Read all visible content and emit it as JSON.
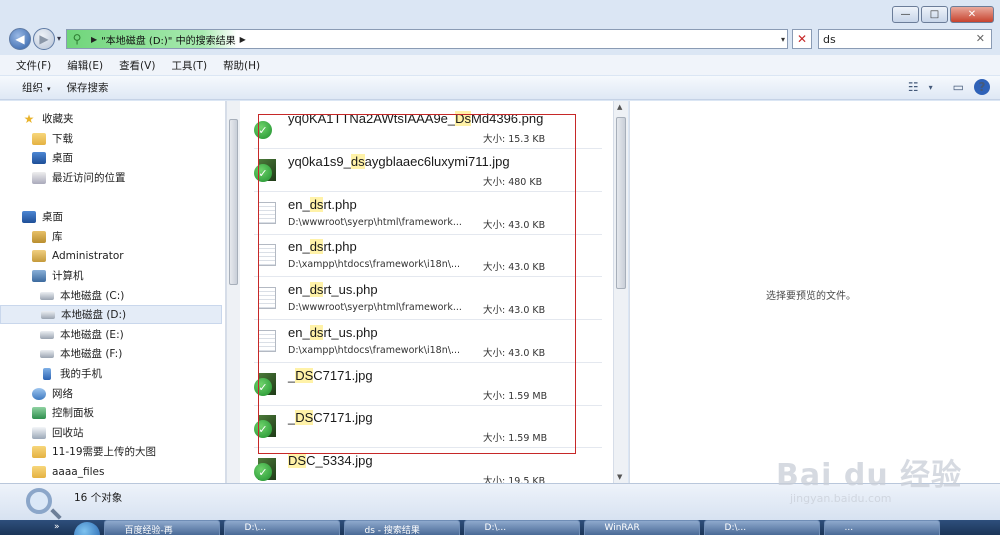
{
  "window": {
    "minimize_glyph": "—",
    "maximize_glyph": "□",
    "close_glyph": "✕"
  },
  "navigation": {
    "back_glyph": "◀",
    "forward_glyph": "▶",
    "history_glyph": "▾"
  },
  "address_bar": {
    "search_icon": "magnifier-icon",
    "breadcrumb": "\"本地磁盘 (D:)\" 中的搜索结果",
    "separator": "▶",
    "dropdown_glyph": "▾",
    "stop_glyph": "✕"
  },
  "search": {
    "value": "ds",
    "clear_glyph": "✕"
  },
  "menu": [
    "文件(F)",
    "编辑(E)",
    "查看(V)",
    "工具(T)",
    "帮助(H)"
  ],
  "commands": {
    "organize": "组织",
    "save_search": "保存搜索",
    "arrow": "▾",
    "view_glyph": "☷",
    "view_arrow": "▾",
    "preview_glyph": "▭",
    "help_glyph": "?"
  },
  "nav_pane": {
    "items": [
      {
        "label": "收藏夹",
        "icon": "star-icon"
      },
      {
        "label": "下载",
        "icon": "download-folder-icon"
      },
      {
        "label": "桌面",
        "icon": "desktop-icon"
      },
      {
        "label": "最近访问的位置",
        "icon": "recent-places-icon"
      },
      {
        "label": "桌面",
        "icon": "desktop-icon"
      },
      {
        "label": "库",
        "icon": "library-icon"
      },
      {
        "label": "Administrator",
        "icon": "user-folder-icon"
      },
      {
        "label": "计算机",
        "icon": "computer-icon"
      },
      {
        "label": "本地磁盘 (C:)",
        "icon": "drive-icon"
      },
      {
        "label": "本地磁盘 (D:)",
        "icon": "drive-icon",
        "selected": true
      },
      {
        "label": "本地磁盘 (E:)",
        "icon": "drive-icon"
      },
      {
        "label": "本地磁盘 (F:)",
        "icon": "drive-icon"
      },
      {
        "label": "我的手机",
        "icon": "phone-icon"
      },
      {
        "label": "网络",
        "icon": "network-icon"
      },
      {
        "label": "控制面板",
        "icon": "control-panel-icon"
      },
      {
        "label": "回收站",
        "icon": "recycle-bin-icon"
      },
      {
        "label": "11-19需要上传的大图",
        "icon": "folder-icon"
      },
      {
        "label": "aaaa_files",
        "icon": "folder-icon"
      }
    ]
  },
  "files": [
    {
      "pre": "yq0KA1TTNa2AWtsIAAA9e_",
      "match": "Ds",
      "post": "Md4396.png",
      "path": "",
      "size": "大小: 15.3 KB",
      "type": "png",
      "synced": true
    },
    {
      "pre": "yq0ka1s9_",
      "match": "ds",
      "post": "aygblaaec6luxymi711.jpg",
      "path": "",
      "size": "大小: 480 KB",
      "type": "img",
      "synced": true
    },
    {
      "pre": "en_",
      "match": "ds",
      "post": "rt.php",
      "path": "D:\\wwwroot\\syerp\\html\\framework...",
      "size": "大小: 43.0 KB",
      "type": "doc",
      "synced": false
    },
    {
      "pre": "en_",
      "match": "ds",
      "post": "rt.php",
      "path": "D:\\xampp\\htdocs\\framework\\i18n\\...",
      "size": "大小: 43.0 KB",
      "type": "doc",
      "synced": false
    },
    {
      "pre": "en_",
      "match": "ds",
      "post": "rt_us.php",
      "path": "D:\\wwwroot\\syerp\\html\\framework...",
      "size": "大小: 43.0 KB",
      "type": "doc",
      "synced": false
    },
    {
      "pre": "en_",
      "match": "ds",
      "post": "rt_us.php",
      "path": "D:\\xampp\\htdocs\\framework\\i18n\\...",
      "size": "大小: 43.0 KB",
      "type": "doc",
      "synced": false
    },
    {
      "pre": "_",
      "match": "DS",
      "post": "C7171.jpg",
      "path": "",
      "size": "大小: 1.59 MB",
      "type": "img",
      "synced": true
    },
    {
      "pre": "_",
      "match": "DS",
      "post": "C7171.jpg",
      "path": "",
      "size": "大小: 1.59 MB",
      "type": "img",
      "synced": true
    },
    {
      "pre": "",
      "match": "DS",
      "post": "C_5334.jpg",
      "path": "",
      "size": "大小: 19.5 KB",
      "type": "img",
      "synced": true
    }
  ],
  "scroll_glyphs": {
    "up": "▲",
    "down": "▼"
  },
  "preview": {
    "message": "选择要预览的文件。"
  },
  "status": {
    "count": "16 个对象"
  },
  "watermark": {
    "big": "Bai du 经验",
    "small": "jingyan.baidu.com"
  },
  "taskbar": {
    "chevron": "»",
    "buttons": [
      "百度经验-再",
      "D:\\...",
      "ds - 搜索结果",
      "D:\\...",
      "WinRAR",
      "D:\\...",
      "..."
    ]
  }
}
